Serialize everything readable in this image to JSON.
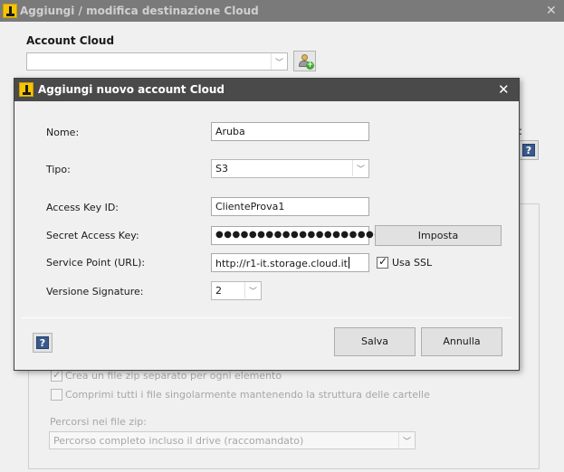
{
  "background_window": {
    "title": "Aggiungi / modifica destinazione Cloud",
    "close_glyph": "✕",
    "account_cloud_label": "Account Cloud",
    "account_cloud_value": "",
    "partial_label": ":",
    "create_zip_label": "Crea un file zip separato per ogni elemento",
    "compress_label": "Comprimi tutti i file singolarmente mantenendo la struttura delle cartelle",
    "paths_label": "Percorsi nei file zip:",
    "paths_value": "Percorso completo incluso il drive (raccomandato)"
  },
  "dialog": {
    "title": "Aggiungi nuovo account Cloud",
    "close_glyph": "✕",
    "fields": {
      "nome_label": "Nome:",
      "nome_value": "Aruba",
      "tipo_label": "Tipo:",
      "tipo_value": "S3",
      "access_key_label": "Access Key ID:",
      "access_key_value": "ClienteProva1",
      "secret_key_label": "Secret Access Key:",
      "secret_key_value": "●●●●●●●●●●●●●●●●●●●●●●●●●",
      "service_point_label": "Service Point (URL):",
      "service_point_value": "http://r1-it.storage.cloud.it",
      "versione_label": "Versione Signature:",
      "versione_value": "2"
    },
    "imposta_label": "Imposta",
    "use_ssl_label": "Usa SSL",
    "use_ssl_checked": true,
    "save_label": "Salva",
    "cancel_label": "Annulla",
    "help_glyph": "?"
  },
  "icons": {
    "dropdown_arrow": "﹀",
    "check_mark": "✓"
  }
}
